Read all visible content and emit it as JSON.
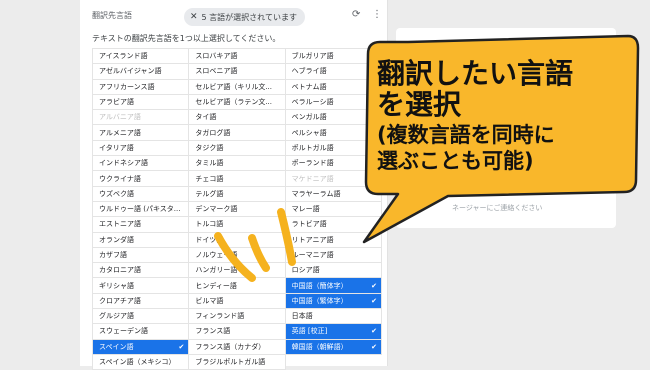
{
  "panel": {
    "header_label": "翻訳先言語",
    "chip_text": "5 言語が選択されています",
    "instruction": "テキストの翻訳先言語を1つ以上選択してください。"
  },
  "languages": [
    {
      "label": "アイスランド語",
      "state": "normal"
    },
    {
      "label": "アゼルバイジャン語",
      "state": "normal"
    },
    {
      "label": "アフリカーンス語",
      "state": "normal"
    },
    {
      "label": "アラビア語",
      "state": "normal"
    },
    {
      "label": "アルバニア語",
      "state": "disabled"
    },
    {
      "label": "アルメニア語",
      "state": "normal"
    },
    {
      "label": "イタリア語",
      "state": "normal"
    },
    {
      "label": "インドネシア語",
      "state": "normal"
    },
    {
      "label": "ウクライナ語",
      "state": "normal"
    },
    {
      "label": "ウズベク語",
      "state": "normal"
    },
    {
      "label": "ウルドゥー語 (パキスタ...",
      "state": "normal"
    },
    {
      "label": "エストニア語",
      "state": "normal"
    },
    {
      "label": "オランダ語",
      "state": "normal"
    },
    {
      "label": "カザフ語",
      "state": "normal"
    },
    {
      "label": "カタロニア語",
      "state": "normal"
    },
    {
      "label": "ギリシャ語",
      "state": "normal"
    },
    {
      "label": "クロアチア語",
      "state": "normal"
    },
    {
      "label": "グルジア語",
      "state": "normal"
    },
    {
      "label": "スウェーデン語",
      "state": "normal"
    },
    {
      "label": "スペイン語",
      "state": "selected"
    },
    {
      "label": "スペイン語（メキシコ）",
      "state": "normal"
    },
    {
      "label": "スロバキア語",
      "state": "normal"
    },
    {
      "label": "スロベニア語",
      "state": "normal"
    },
    {
      "label": "セルビア語（キリル文...",
      "state": "normal"
    },
    {
      "label": "セルビア語（ラテン文...",
      "state": "normal"
    },
    {
      "label": "タイ語",
      "state": "normal"
    },
    {
      "label": "タガログ語",
      "state": "normal"
    },
    {
      "label": "タジク語",
      "state": "normal"
    },
    {
      "label": "タミル語",
      "state": "normal"
    },
    {
      "label": "チェコ語",
      "state": "normal"
    },
    {
      "label": "テルグ語",
      "state": "normal"
    },
    {
      "label": "デンマーク語",
      "state": "normal"
    },
    {
      "label": "トルコ語",
      "state": "normal"
    },
    {
      "label": "ドイツ語",
      "state": "normal"
    },
    {
      "label": "ノルウェー語",
      "state": "normal"
    },
    {
      "label": "ハンガリー語",
      "state": "normal"
    },
    {
      "label": "ヒンディー語",
      "state": "normal"
    },
    {
      "label": "ビルマ語",
      "state": "normal"
    },
    {
      "label": "フィンランド語",
      "state": "normal"
    },
    {
      "label": "フランス語",
      "state": "normal"
    },
    {
      "label": "フランス語（カナダ）",
      "state": "normal"
    },
    {
      "label": "ブラジルポルトガル語",
      "state": "normal"
    },
    {
      "label": "ブルガリア語",
      "state": "normal"
    },
    {
      "label": "ヘブライ語",
      "state": "normal"
    },
    {
      "label": "ベトナム語",
      "state": "normal"
    },
    {
      "label": "ベラルーシ語",
      "state": "normal"
    },
    {
      "label": "ベンガル語",
      "state": "normal"
    },
    {
      "label": "ペルシャ語",
      "state": "normal"
    },
    {
      "label": "ポルトガル語",
      "state": "normal"
    },
    {
      "label": "ポーランド語",
      "state": "normal"
    },
    {
      "label": "マケドニア語",
      "state": "disabled"
    },
    {
      "label": "マラヤーラム語",
      "state": "normal"
    },
    {
      "label": "マレー語",
      "state": "normal"
    },
    {
      "label": "ラトビア語",
      "state": "normal"
    },
    {
      "label": "リトアニア語",
      "state": "normal"
    },
    {
      "label": "ルーマニア語",
      "state": "normal"
    },
    {
      "label": "ロシア語",
      "state": "normal"
    },
    {
      "label": "中国語（簡体字）",
      "state": "selected"
    },
    {
      "label": "中国語（繁体字）",
      "state": "selected"
    },
    {
      "label": "日本語",
      "state": "normal"
    },
    {
      "label": "英語 [校正]",
      "state": "selected"
    },
    {
      "label": "韓国語（朝鮮語）",
      "state": "selected"
    }
  ],
  "right_link": "ネージャーにご連絡ください",
  "callout": {
    "line1": "翻訳したい言語",
    "line2": "を選択",
    "line3": "(複数言語を同時に",
    "line4": "選ぶことも可能)"
  },
  "colors": {
    "callout_fill": "#f9b72b",
    "selected_fill": "#1a73e8",
    "marker": "#f5b21e"
  },
  "icons": {
    "chip_close": "close-icon",
    "chip_check": "check-icon",
    "header_sync": "sync-icon",
    "header_more": "more-vert-icon"
  }
}
